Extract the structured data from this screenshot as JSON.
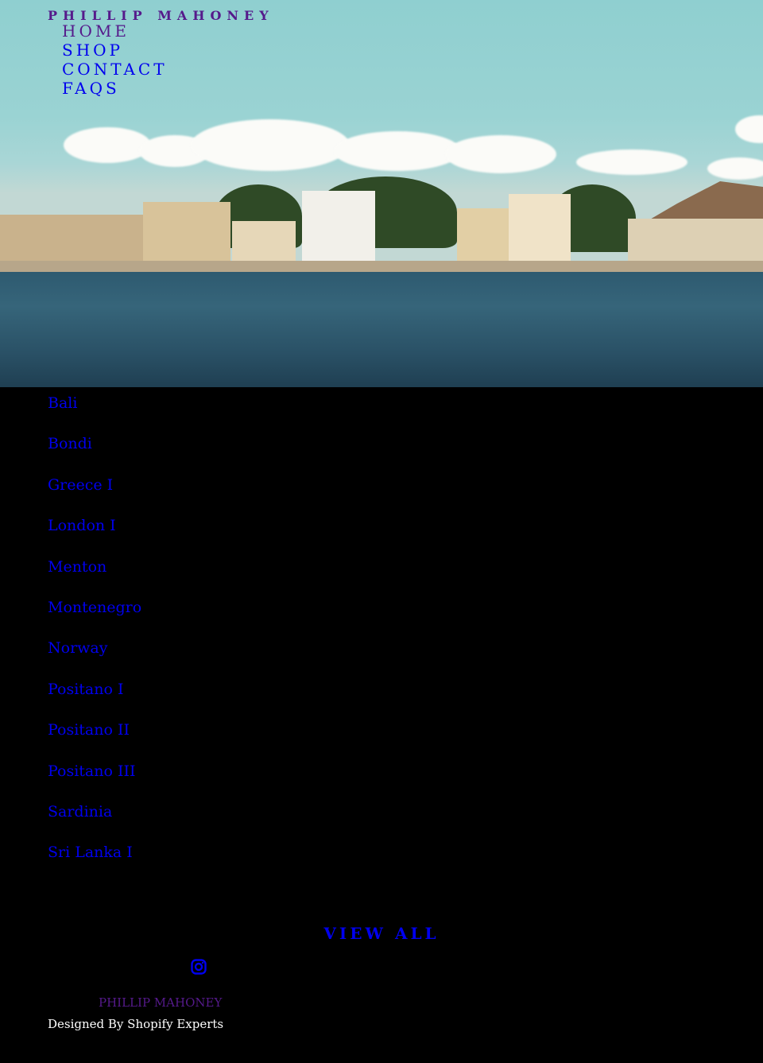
{
  "header": {
    "brand": "PHILLIP MAHONEY",
    "nav": [
      {
        "label": "HOME",
        "visited": true
      },
      {
        "label": "SHOP",
        "visited": false
      },
      {
        "label": "CONTACT",
        "visited": false
      },
      {
        "label": "FAQS",
        "visited": false
      }
    ]
  },
  "hero": {
    "image": "waterfront-town-photo"
  },
  "collections": [
    {
      "label": "Bali"
    },
    {
      "label": "Bondi"
    },
    {
      "label": "Greece I"
    },
    {
      "label": "London I"
    },
    {
      "label": "Menton"
    },
    {
      "label": "Montenegro"
    },
    {
      "label": "Norway"
    },
    {
      "label": "Positano I"
    },
    {
      "label": "Positano II"
    },
    {
      "label": "Positano III"
    },
    {
      "label": "Sardinia"
    },
    {
      "label": "Sri Lanka I"
    }
  ],
  "view_all": "VIEW ALL",
  "footer": {
    "social_icon": "instagram-icon",
    "brand": "PHILLIP MAHONEY",
    "credit": "Designed By Shopify Experts"
  },
  "colors": {
    "link": "#0000ee",
    "visited": "#551a8b",
    "background": "#000000"
  }
}
